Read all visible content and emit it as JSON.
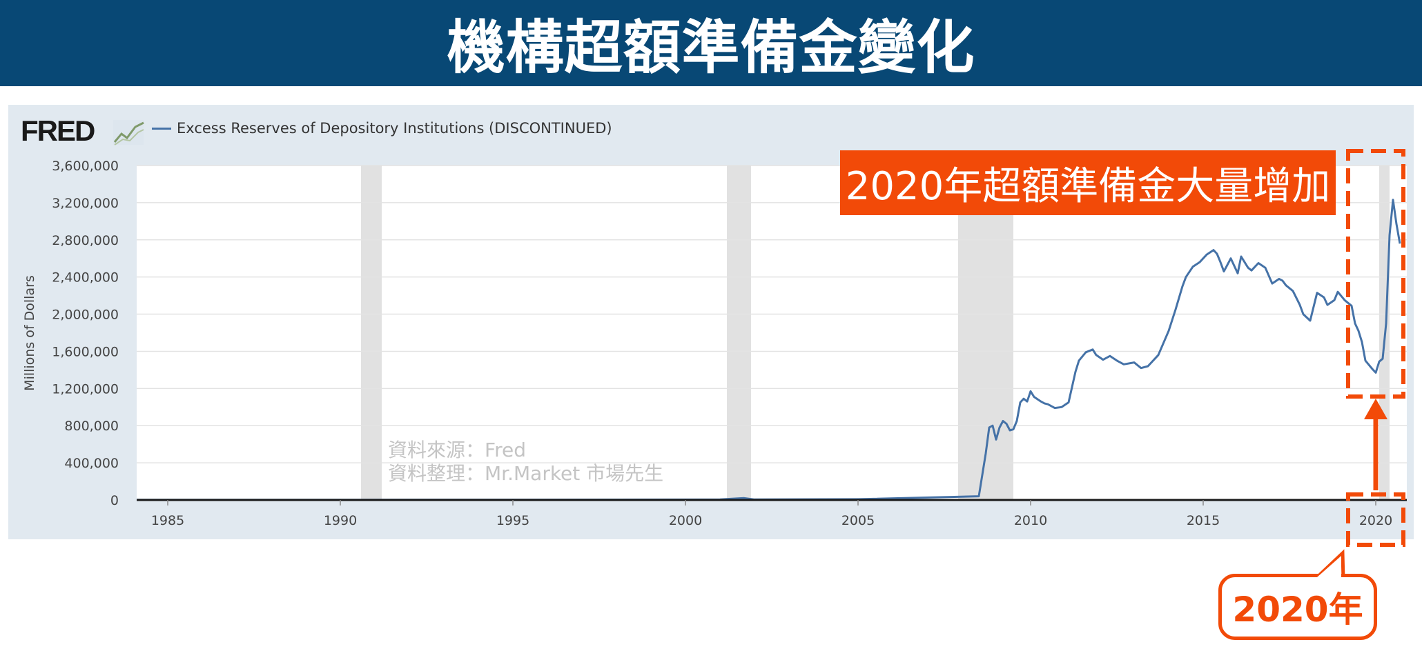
{
  "banner": {
    "title": "機構超額準備金變化"
  },
  "fred": {
    "logo_text": "FRED",
    "logo_icon": "chart-line-icon",
    "legend_label": "Excess Reserves of Depository Institutions (DISCONTINUED)"
  },
  "annotations": {
    "headline": "2020年超額準備金大量增加",
    "year_label": "2020年",
    "source_line1": "資料來源：Fred",
    "source_line2": "資料整理：Mr.Market 市場先生"
  },
  "colors": {
    "banner": "#084875",
    "accent": "#f24a08",
    "series": "#4572a7",
    "panel": "#e1e9f0",
    "recession": "#e1e1e1"
  },
  "chart_data": {
    "type": "line",
    "ylabel": "Millions of Dollars",
    "xlabel": "",
    "xlim": [
      1984.1,
      2020.9
    ],
    "ylim": [
      0,
      3600000
    ],
    "y_ticks": [
      0,
      400000,
      800000,
      1200000,
      1600000,
      2000000,
      2400000,
      2800000,
      3200000,
      3600000
    ],
    "y_tick_labels": [
      "0",
      "400,000",
      "800,000",
      "1,200,000",
      "1,600,000",
      "2,000,000",
      "2,400,000",
      "2,800,000",
      "3,200,000",
      "3,600,000"
    ],
    "x_ticks": [
      1985,
      1990,
      1995,
      2000,
      2005,
      2010,
      2015,
      2020
    ],
    "x_tick_labels": [
      "1985",
      "1990",
      "1995",
      "2000",
      "2005",
      "2010",
      "2015",
      "2020"
    ],
    "recessions": [
      [
        1990.6,
        1991.2
      ],
      [
        2001.2,
        2001.9
      ],
      [
        2007.9,
        2009.5
      ],
      [
        2020.1,
        2020.4
      ]
    ],
    "grid": "horizontal",
    "series": [
      {
        "name": "Excess Reserves of Depository Institutions (DISCONTINUED)",
        "x": [
          1984.1,
          1990.0,
          1995.0,
          2001.0,
          2001.7,
          2002.0,
          2005.0,
          2008.5,
          2008.7,
          2008.8,
          2008.9,
          2009.0,
          2009.1,
          2009.2,
          2009.3,
          2009.4,
          2009.5,
          2009.6,
          2009.7,
          2009.8,
          2009.9,
          2010.0,
          2010.1,
          2010.3,
          2010.4,
          2010.5,
          2010.7,
          2010.9,
          2011.1,
          2011.3,
          2011.4,
          2011.6,
          2011.8,
          2011.9,
          2012.1,
          2012.3,
          2012.5,
          2012.7,
          2013.0,
          2013.2,
          2013.4,
          2013.7,
          2014.0,
          2014.2,
          2014.4,
          2014.5,
          2014.7,
          2014.9,
          2015.0,
          2015.1,
          2015.3,
          2015.4,
          2015.5,
          2015.6,
          2015.8,
          2016.0,
          2016.1,
          2016.3,
          2016.4,
          2016.5,
          2016.6,
          2016.8,
          2017.0,
          2017.2,
          2017.3,
          2017.4,
          2017.6,
          2017.8,
          2017.9,
          2018.1,
          2018.3,
          2018.5,
          2018.6,
          2018.8,
          2018.9,
          2019.1,
          2019.3,
          2019.4,
          2019.5,
          2019.6,
          2019.7,
          2019.9,
          2020.0,
          2020.1,
          2020.2,
          2020.3,
          2020.4,
          2020.5,
          2020.6,
          2020.7
        ],
        "values": [
          2000,
          2000,
          3000,
          5000,
          20000,
          5000,
          8000,
          40000,
          500000,
          780000,
          800000,
          650000,
          780000,
          850000,
          820000,
          750000,
          760000,
          850000,
          1050000,
          1090000,
          1060000,
          1170000,
          1110000,
          1060000,
          1040000,
          1030000,
          990000,
          1000000,
          1050000,
          1380000,
          1500000,
          1590000,
          1620000,
          1560000,
          1510000,
          1550000,
          1500000,
          1460000,
          1480000,
          1420000,
          1440000,
          1560000,
          1820000,
          2050000,
          2300000,
          2400000,
          2510000,
          2560000,
          2600000,
          2640000,
          2690000,
          2650000,
          2560000,
          2460000,
          2600000,
          2440000,
          2620000,
          2500000,
          2470000,
          2510000,
          2550000,
          2500000,
          2330000,
          2380000,
          2360000,
          2310000,
          2250000,
          2100000,
          2000000,
          1930000,
          2230000,
          2180000,
          2100000,
          2150000,
          2240000,
          2150000,
          2090000,
          1900000,
          1820000,
          1700000,
          1500000,
          1410000,
          1370000,
          1490000,
          1520000,
          1900000,
          2850000,
          3230000,
          2970000,
          2760000
        ]
      }
    ]
  }
}
